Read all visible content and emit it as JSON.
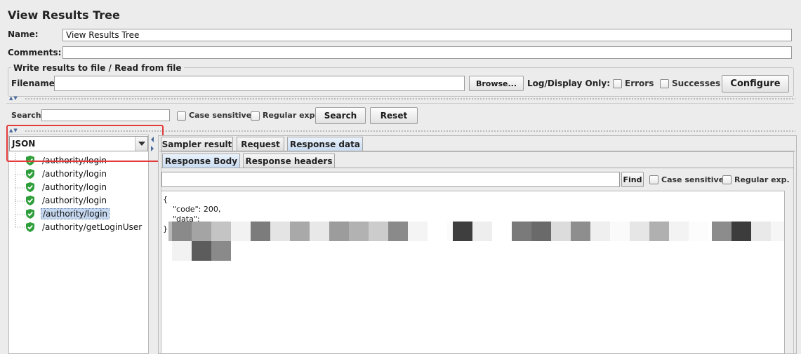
{
  "title": "View Results Tree",
  "name": {
    "label": "Name:",
    "value": "View Results Tree"
  },
  "comments": {
    "label": "Comments:",
    "value": ""
  },
  "file_group": {
    "legend": "Write results to file / Read from file",
    "filename_label": "Filename",
    "filename_value": "",
    "browse_label": "Browse...",
    "log_display_label": "Log/Display Only:",
    "errors_label": "Errors",
    "successes_label": "Successes",
    "configure_label": "Configure"
  },
  "search": {
    "label": "Search:",
    "value": "",
    "case_sensitive_label": "Case sensitive",
    "regex_label": "Regular exp.",
    "search_button": "Search",
    "reset_button": "Reset"
  },
  "renderer": {
    "selected": "JSON"
  },
  "tree": {
    "items": [
      {
        "label": "/authority/login",
        "selected": false
      },
      {
        "label": "/authority/login",
        "selected": false
      },
      {
        "label": "/authority/login",
        "selected": false
      },
      {
        "label": "/authority/login",
        "selected": false
      },
      {
        "label": "/authority/login",
        "selected": true
      },
      {
        "label": "/authority/getLoginUser",
        "selected": false
      }
    ]
  },
  "tabs": {
    "sampler_result": "Sampler result",
    "request": "Request",
    "response_data": "Response data",
    "active": "Response data"
  },
  "subtabs": {
    "response_body": "Response Body",
    "response_headers": "Response headers",
    "active": "Response Body"
  },
  "find": {
    "value": "",
    "find_button": "Find",
    "case_sensitive_label": "Case sensitive",
    "regex_label": "Regular exp."
  },
  "response": {
    "lines": [
      "{",
      "    \"code\": 200,",
      "    \"data\":",
      "",
      "",
      "",
      "}"
    ]
  },
  "colors": {
    "highlight_box": "#e33a3a",
    "selected_item_bg": "#c6d8f0",
    "active_tab": "#c9dcf2",
    "success_icon": "#2e9e3a"
  }
}
